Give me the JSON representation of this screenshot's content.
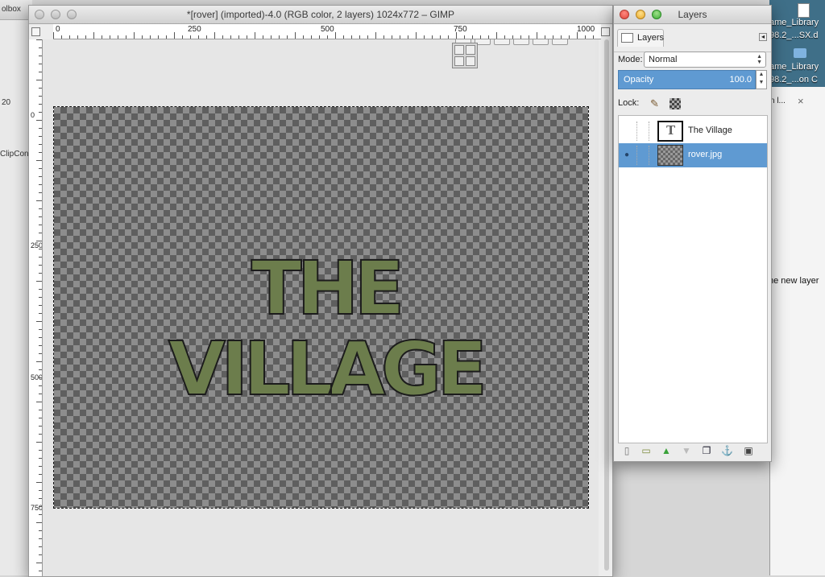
{
  "background": {
    "left_app": {
      "title": "olbox",
      "items": [
        "20",
        "ClipCon"
      ]
    },
    "desktop_files": [
      {
        "name": "ame_Library",
        "sub": "98.2_...SX.d"
      },
      {
        "name": "ame_Library",
        "sub": "98.2_...on C"
      }
    ],
    "browser": {
      "tab_label": "n l...",
      "close": "×",
      "content_text": "he new layer"
    }
  },
  "image_window": {
    "title": "*[rover] (imported)-4.0 (RGB color, 2 layers) 1024x772 – GIMP",
    "hruler_labels": [
      "0",
      "250",
      "500",
      "750",
      "1000"
    ],
    "vruler_labels": [
      "0",
      "250",
      "500",
      "750"
    ],
    "canvas_text": "THE VILLAGE"
  },
  "layers_dock": {
    "title": "Layers",
    "tab_label": "Layers",
    "mode_label": "Mode:",
    "mode_value": "Normal",
    "opacity_label": "Opacity",
    "opacity_value": "100.0",
    "lock_label": "Lock:",
    "layers": [
      {
        "name": "The Village",
        "type": "text",
        "visible": false,
        "selected": false
      },
      {
        "name": "rover.jpg",
        "type": "image",
        "visible": true,
        "selected": true
      }
    ],
    "buttons": [
      "new-layer",
      "new-layer-group",
      "raise-layer",
      "lower-layer",
      "duplicate-layer",
      "anchor-layer",
      "delete-layer"
    ]
  },
  "colors": {
    "selection": "#5f9ad2",
    "text_fill": "#6c7d4c"
  }
}
